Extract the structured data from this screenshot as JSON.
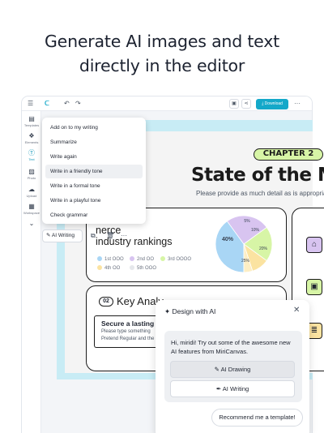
{
  "headline": {
    "line1": "Generate AI images and text",
    "line2": "directly in the editor"
  },
  "topbar": {
    "download_label": "Download",
    "accent": "#14a8c9"
  },
  "sidebar": {
    "items": [
      {
        "label": "Templates",
        "icon": "template-icon"
      },
      {
        "label": "Elements",
        "icon": "elements-icon"
      },
      {
        "label": "Text",
        "icon": "text-icon",
        "active": true
      },
      {
        "label": "Photo",
        "icon": "photo-icon"
      },
      {
        "label": "Upload",
        "icon": "upload-icon"
      },
      {
        "label": "Workspace",
        "icon": "workspace-icon"
      }
    ]
  },
  "ai_writing_menu": {
    "items": [
      "Add on to my writing",
      "Summarize",
      "Write again",
      "Write in a friendly tone",
      "Write in a formal tone",
      "Write in a playful tone",
      "Check grammar"
    ],
    "highlighted": "Write in a friendly tone"
  },
  "mini_toolbar": {
    "ai_writing_label": "AI Writing",
    "more_label": "···"
  },
  "slide": {
    "chapter": "CHAPTER 2",
    "title": "State of the M",
    "subtitle": "Please provide as much detail as is appropriat",
    "rankings_title_line1": "nerce",
    "rankings_title_line2": "industry rankings",
    "legend": [
      {
        "label": "1st OOO",
        "color": "#a9d6f5"
      },
      {
        "label": "2nd OO",
        "color": "#d8c4f0"
      },
      {
        "label": "3rd OOOO",
        "color": "#d7f5a6"
      },
      {
        "label": "4th OO",
        "color": "#fbe3a1"
      },
      {
        "label": "5th OOO",
        "color": "#e5e7eb"
      }
    ],
    "pie_labels": [
      "5%",
      "10%",
      "40%",
      "25%",
      "20%"
    ],
    "key_badge": "02",
    "key_title": "Key Analy",
    "key_box_title": "Secure a lasting ed",
    "key_box_line1": "Please type something",
    "key_box_line2": "Pretend Regular and the"
  },
  "chart_data": {
    "type": "pie",
    "categories": [
      "1st OOO",
      "2nd OO",
      "3rd OOOO",
      "4th OO",
      "5th OOO"
    ],
    "values": [
      40,
      25,
      20,
      10,
      5
    ],
    "colors": [
      "#a9d6f5",
      "#d8c4f0",
      "#d7f5a6",
      "#fbe3a1",
      "#fdeec4"
    ]
  },
  "ai_panel": {
    "title": "Design with AI",
    "message": "Hi, miridi! Try out some of the awesome new AI features from MiriCanvas.",
    "drawing_label": "AI Drawing",
    "writing_label": "AI Writing",
    "recommend_label": "Recommend me a template!"
  }
}
